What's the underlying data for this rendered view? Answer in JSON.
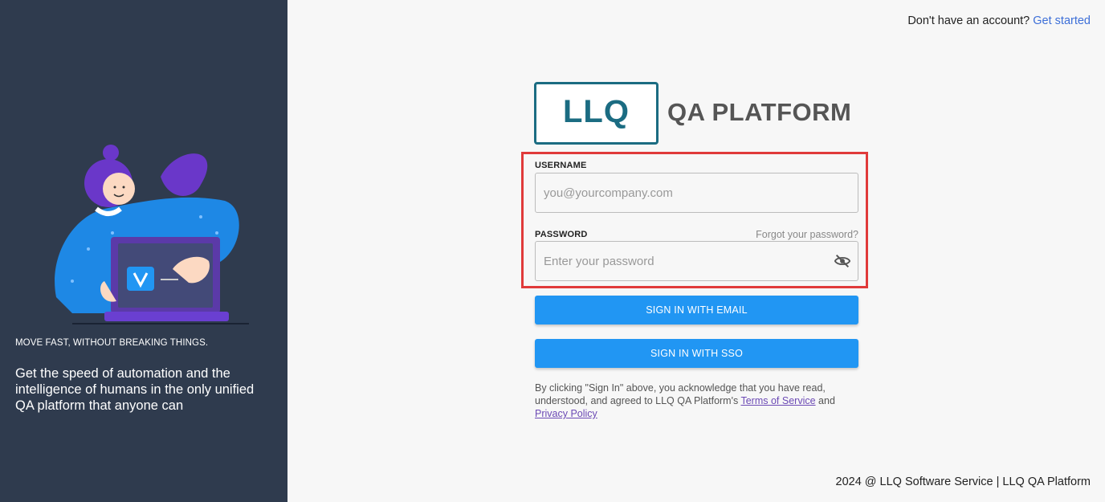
{
  "left": {
    "tagline": "MOVE FAST, WITHOUT BREAKING THINGS.",
    "pitch": "Get the speed of automation and the intelligence of humans in the only unified QA platform that anyone can"
  },
  "header": {
    "prompt": "Don't have an account?",
    "link": "Get started"
  },
  "logo": {
    "mark": "LLQ",
    "text": "QA PLATFORM"
  },
  "form": {
    "username_label": "USERNAME",
    "username_placeholder": "you@yourcompany.com",
    "username_value": "",
    "password_label": "PASSWORD",
    "password_placeholder": "Enter your password",
    "password_value": "",
    "forgot_label": "Forgot your password?",
    "email_button": "SIGN IN WITH EMAIL",
    "sso_button": "SIGN IN WITH SSO"
  },
  "legal": {
    "text_before": "By clicking \"Sign In\" above, you acknowledge that you have read, understood, and agreed to LLQ QA Platform's ",
    "terms": "Terms of Service",
    "middle": " and ",
    "privacy": "Privacy Policy"
  },
  "footer": {
    "text": "2024 @ LLQ Software Service | LLQ QA Platform"
  },
  "colors": {
    "left_bg": "#2f3b4e",
    "accent": "#2196f3",
    "logo": "#1b6c82",
    "highlight": "#e03a3a",
    "link": "#3d6fd8"
  },
  "icons": {
    "eye": "eye-slash-icon",
    "illustration": "woman-with-laptop-illustration"
  }
}
